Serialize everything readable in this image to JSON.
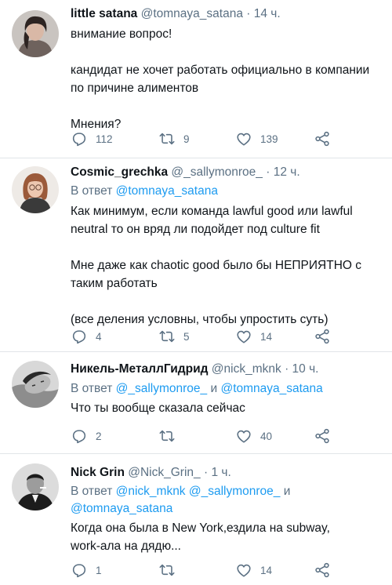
{
  "tweets": [
    {
      "name": "little satana",
      "handle": "@tomnaya_satana",
      "sep": "·",
      "time": "14 ч.",
      "body": [
        "внимание вопрос!",
        "",
        "кандидат не хочет работать официально в компании",
        "по причине алиментов",
        "",
        "Мнения?"
      ],
      "replies": "112",
      "retweets": "9",
      "likes": "139"
    },
    {
      "name": "Cosmic_grechka",
      "handle": "@_sallymonroe_",
      "sep": "·",
      "time": "12 ч.",
      "reply_prefix": "В ответ",
      "reply_to": "@tomnaya_satana",
      "body": [
        "Как минимум, если команда lawful good или lawful",
        "neutral то он вряд ли подойдет под culture fit",
        "",
        "Мне даже как chaotic good было бы НЕПРИЯТНО с",
        "таким работать",
        "",
        "(все деления условны, чтобы упростить суть)"
      ],
      "replies": "4",
      "retweets": "5",
      "likes": "14"
    },
    {
      "name": "Никель-МеталлГидрид",
      "handle": "@nick_mknk",
      "sep": "·",
      "time": "10 ч.",
      "reply_prefix": "В ответ",
      "reply_to": "@_sallymonroe_",
      "reply_and": "и",
      "reply_to2": "@tomnaya_satana",
      "body": [
        "Что ты вообще сказала сейчас"
      ],
      "replies": "2",
      "retweets": "",
      "likes": "40"
    },
    {
      "name": "Nick Grin",
      "handle": "@Nick_Grin_",
      "sep": "·",
      "time": "1 ч.",
      "reply_prefix": "В ответ",
      "reply_to": "@nick_mknk @_sallymonroe_",
      "reply_and": "и",
      "reply_to2": "@tomnaya_satana",
      "body": [
        "Когда она была в New York,ездила на subway,",
        "work-ала на дядю..."
      ],
      "replies": "1",
      "retweets": "",
      "likes": "14"
    }
  ],
  "colors": {
    "text": "#0f1419",
    "muted": "#5b7083",
    "link": "#1d9bf0",
    "divider": "#e1e5e8"
  },
  "icons": [
    "reply-icon",
    "retweet-icon",
    "like-icon",
    "share-icon"
  ]
}
